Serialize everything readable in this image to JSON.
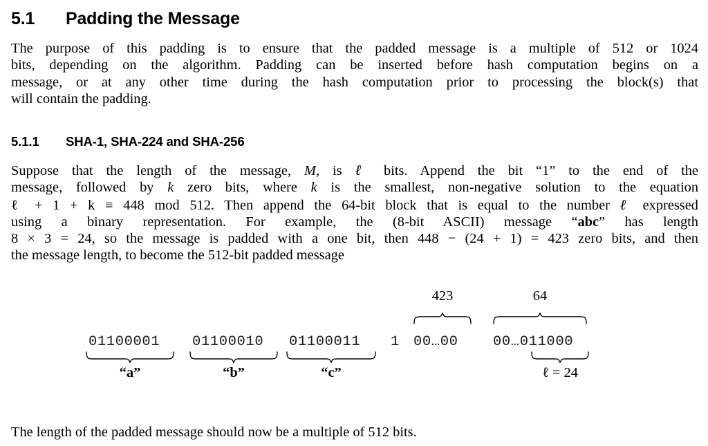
{
  "document": {
    "section": {
      "number": "5.1",
      "title": "Padding the Message"
    },
    "intro_paragraph": {
      "line1": "The purpose of this padding is to ensure that the padded message is a multiple of 512 or 1024",
      "line2": "bits, depending on the algorithm. Padding can be inserted before hash computation begins   on a",
      "line3": "message, or at any other time during the hash computation prior to processing the block(s) that",
      "line4": "will contain the padding."
    },
    "subsection": {
      "number": "5.1.1",
      "title": "SHA-1, SHA-224 and SHA-256"
    },
    "sha_paragraph": {
      "l1_a": "Suppose that the length of the message, ",
      "l1_M": "M",
      "l1_b": ", is ",
      "l1_ell": "ℓ",
      "l1_c": " bits.  Append the bit “1” to the end of the",
      "l2_a": "message, followed by ",
      "l2_k1": "k",
      "l2_b": " zero bits, where ",
      "l2_k2": "k",
      "l2_c": " is the smallest, non-negative solution to the equation",
      "l3_math": "ℓ + 1 + k ≡ 448 mod 512",
      "l3_a": ". Then append the 64-bit block that is equal to the number ",
      "l3_ell": "ℓ",
      "l3_b": " expressed",
      "l4_a": "using a binary representation. For example, the (8-bit ASCII) message “",
      "l4_abc": "abc",
      "l4_b": "” has length",
      "l5_math1": "8 × 3 = 24",
      "l5_a": ", so the message is padded with a one bit, then ",
      "l5_math2": "448 − (24 + 1) = 423",
      "l5_b": " zero bits, and then",
      "l6": "the message length, to become the 512-bit padded message"
    },
    "figure": {
      "byte_a": {
        "bits": "01100001",
        "label": "“a”"
      },
      "byte_b": {
        "bits": "01100010",
        "label": "“b”"
      },
      "byte_c": {
        "bits": "01100011",
        "label": "“c”"
      },
      "one_bit": "1",
      "zero_padding": {
        "bits": "00…00",
        "count_label": "423"
      },
      "length_block": {
        "bits": "00…011000",
        "count_label": "64",
        "value_label": "ℓ = 24"
      }
    },
    "closing_paragraph": "The length of the padded message should now be a multiple of 512 bits."
  },
  "colors": {
    "background": "#ffffff",
    "text": "#000000",
    "mono_text": "#1a1a1a"
  }
}
